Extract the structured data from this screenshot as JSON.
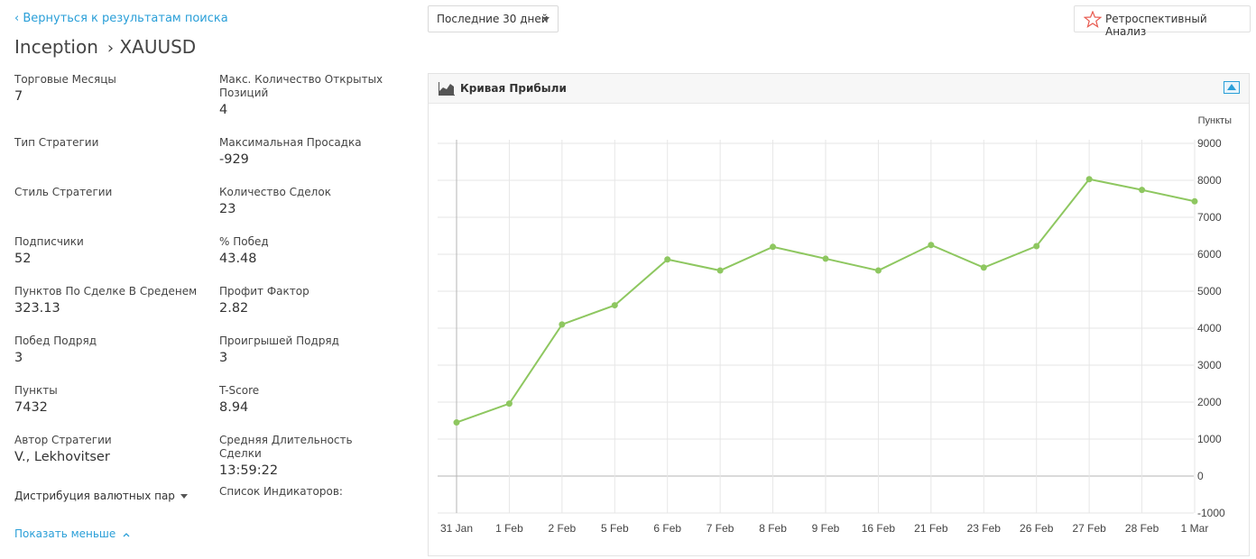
{
  "nav": {
    "back_label": "‹ Вернуться к результатам поиска"
  },
  "header": {
    "strategy_name": "Inception",
    "separator": "›",
    "symbol": "XAUUSD"
  },
  "toolbar": {
    "period_value": "Последние 30 дней",
    "retro_label": "Ретроспективный Анализ",
    "retro_icon": "star-outline-icon",
    "accent_color": "#2a9fd8",
    "star_color": "#e85a4f"
  },
  "stats": {
    "left": [
      {
        "label": "Торговые Месяцы",
        "value": "7"
      },
      {
        "label": "Тип Стратегии",
        "value": ""
      },
      {
        "label": "Стиль Стратегии",
        "value": ""
      },
      {
        "label": "Подписчики",
        "value": "52"
      },
      {
        "label": "Пунктов По Сделке В Среденем",
        "value": "323.13"
      },
      {
        "label": "Побед Подряд",
        "value": "3"
      },
      {
        "label": "Пункты",
        "value": "7432"
      },
      {
        "label": "Автор Стратегии",
        "value": "V., Lekhovitser"
      }
    ],
    "right": [
      {
        "label": "Макс. Количество Открытых Позиций",
        "value": "4"
      },
      {
        "label": "Максимальная Просадка",
        "value": "-929"
      },
      {
        "label": "Количество Сделок",
        "value": "23"
      },
      {
        "label": "% Побед",
        "value": "43.48"
      },
      {
        "label": "Профит Фактор",
        "value": "2.82"
      },
      {
        "label": "Проигрышей Подряд",
        "value": "3"
      },
      {
        "label": "T-Score",
        "value": "8.94"
      },
      {
        "label": "Средняя Длительность Сделки",
        "value": "13:59:22"
      }
    ]
  },
  "distribution": {
    "label": "Дистрибуция валютных пар"
  },
  "indicators": {
    "label": "Список Индикаторов:"
  },
  "show_less": {
    "label": "Показать меньше",
    "icon": "chevron-up-icon"
  },
  "panel": {
    "title": "Кривая Прибыли",
    "icon": "area-chart-icon",
    "expand_icon": "expand-icon"
  },
  "chart_data": {
    "type": "line",
    "title": "Кривая Прибыли",
    "ylabel": "Пункты",
    "xlabel": "",
    "categories": [
      "31 Jan",
      "1 Feb",
      "2 Feb",
      "5 Feb",
      "6 Feb",
      "7 Feb",
      "8 Feb",
      "9 Feb",
      "16 Feb",
      "21 Feb",
      "23 Feb",
      "26 Feb",
      "27 Feb",
      "28 Feb",
      "1 Mar"
    ],
    "series": [
      {
        "values": [
          1450,
          1960,
          4100,
          4620,
          5860,
          5560,
          6200,
          5880,
          5560,
          6250,
          5640,
          6220,
          8030,
          7740,
          7432
        ]
      }
    ],
    "ylim": [
      -1000,
      9000
    ],
    "yticks": [
      9000,
      8000,
      7000,
      6000,
      5000,
      4000,
      3000,
      2000,
      1000,
      0,
      -1000
    ],
    "grid": true,
    "legend": "none",
    "line_color": "#8ec760",
    "grid_color": "#e6e6e6"
  }
}
